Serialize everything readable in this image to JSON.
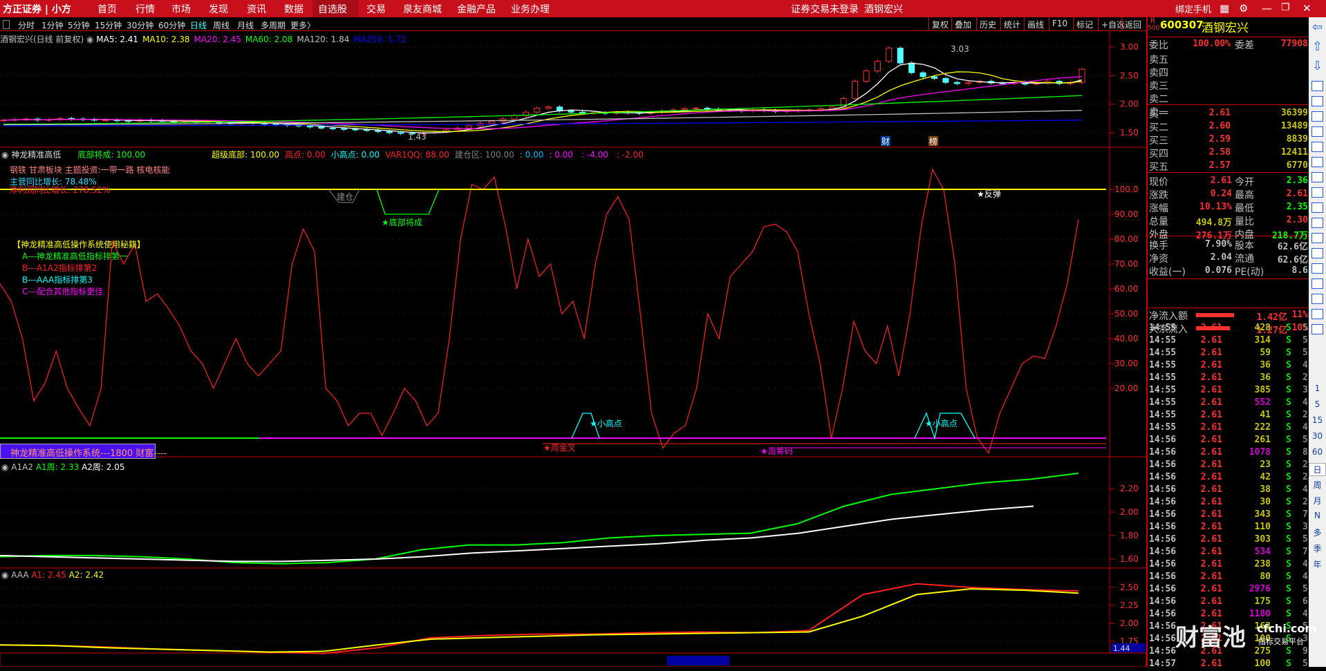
{
  "nav": {
    "logo": "方正证券 | 小方",
    "items": [
      "首页",
      "行情",
      "市场",
      "发现",
      "资讯",
      "数据",
      "自选股",
      "交易",
      "泉友商城",
      "金融产品",
      "业务办理"
    ],
    "active": "自选股",
    "login_status": "证券交易未登录",
    "stock": "酒钢宏兴",
    "bind_phone": "绑定手机"
  },
  "periods": [
    "分时",
    "1分钟",
    "5分钟",
    "15分钟",
    "30分钟",
    "60分钟",
    "日线",
    "周线",
    "月线",
    "多周期",
    "更多〉"
  ],
  "active_period": "日线",
  "toolbar": [
    "复权",
    "叠加",
    "历史",
    "统计",
    "画线",
    "F10",
    "标记",
    "+自选",
    "返回"
  ],
  "main_legend": {
    "title": "酒钢宏兴(日线 前复权)",
    "ma": [
      {
        "t": "MA5: 2.41",
        "c": "#ffffff"
      },
      {
        "t": "MA10: 2.38",
        "c": "#ffff00"
      },
      {
        "t": "MA20: 2.45",
        "c": "#ff00ff"
      },
      {
        "t": "MA60: 2.08",
        "c": "#00ff00"
      },
      {
        "t": "MA120: 1.84",
        "c": "#c0c0c0"
      },
      {
        "t": "MA250: 1.72",
        "c": "#0000ff"
      }
    ]
  },
  "ind1": {
    "name": "神龙精准高低",
    "values": [
      {
        "t": "底部将成: 100.00",
        "c": "#00ff00"
      },
      {
        "t": "超级底部: 100.00",
        "c": "#ffff00"
      },
      {
        "t": "高点: 0.00",
        "c": "#ff2020"
      },
      {
        "t": "小高点: 0.00",
        "c": "#00ffff"
      },
      {
        "t": "VAR1QQ: 88.00",
        "c": "#ff2020"
      },
      {
        "t": "建仓区: 100.00",
        "c": "#808080"
      },
      {
        "t": ": 0.00",
        "c": "#00c0ff"
      },
      {
        "t": ": 0.00",
        "c": "#ff00ff"
      },
      {
        "t": ": -4.00",
        "c": "#ff00ff"
      },
      {
        "t": ": -2.00",
        "c": "#ff2020"
      }
    ],
    "sector": "钢铁 甘肃板块 主题投资:一带一路 核电核能",
    "revenue": "主营同比增长: 78.48%",
    "profit": "净利润同比增长: 278.52%",
    "guide": [
      "【神龙精准高低操作系统使用秘籍】",
      "A---神龙精准高低指标排第一",
      "B---A1A2指标排第2",
      "B---AAA指标排第3",
      "C---配合其他指标更佳"
    ],
    "labels": {
      "jiancang": "建仓",
      "bottom": "★底部将成",
      "rebound": "★反弹",
      "small_high": "★小高点",
      "week_cross": "★周金叉",
      "week_chip": "★周筹码"
    },
    "banner": "神龙精准高低操作系统---1800 财富----"
  },
  "ind2": {
    "name": "A1A2",
    "a1": "A1周: 2.33",
    "a2": "A2周: 2.05"
  },
  "ind3": {
    "name": "AAA",
    "a1": "A1: 2.45",
    "a2": "A2: 2.42"
  },
  "chart_data": [
    {
      "type": "candlestick",
      "ylim": [
        1.35,
        3.2
      ],
      "yticks": [
        "3.00",
        "2.50",
        "2.00",
        "1.50"
      ],
      "high_label": "3.03",
      "low_label": "1.43",
      "markers": [
        "财",
        "榜"
      ],
      "closes": [
        1.72,
        1.73,
        1.74,
        1.72,
        1.73,
        1.75,
        1.74,
        1.73,
        1.72,
        1.72,
        1.71,
        1.7,
        1.72,
        1.71,
        1.7,
        1.69,
        1.7,
        1.68,
        1.69,
        1.67,
        1.66,
        1.68,
        1.67,
        1.65,
        1.64,
        1.63,
        1.62,
        1.6,
        1.58,
        1.57,
        1.56,
        1.55,
        1.54,
        1.52,
        1.5,
        1.49,
        1.48,
        1.5,
        1.52,
        1.55,
        1.58,
        1.62,
        1.66,
        1.7,
        1.74,
        1.8,
        1.86,
        1.93,
        1.95,
        1.88,
        1.86,
        1.84,
        1.85,
        1.84,
        1.86,
        1.85,
        1.84,
        1.86,
        1.88,
        1.9,
        1.92,
        1.93,
        1.91,
        1.9,
        1.89,
        1.88,
        1.9,
        1.89,
        1.87,
        1.88,
        1.89,
        1.9,
        1.92,
        1.95,
        2.1,
        2.4,
        2.58,
        2.75,
        2.98,
        2.72,
        2.55,
        2.48,
        2.45,
        2.38,
        2.36,
        2.38,
        2.4,
        2.37,
        2.36,
        2.38,
        2.35,
        2.37,
        2.4,
        2.36,
        2.38,
        2.61
      ]
    },
    {
      "type": "line",
      "ylim": [
        -8,
        112
      ],
      "yticks": [
        "100.0",
        "90.00",
        "80.00",
        "70.00",
        "60.00",
        "50.00",
        "40.00",
        "30.00",
        "20.00"
      ],
      "series": [
        {
          "values": [
            62,
            55,
            40,
            15,
            22,
            35,
            20,
            12,
            5,
            20,
            79,
            70,
            78,
            55,
            58,
            52,
            45,
            35,
            30,
            20,
            30,
            40,
            30,
            25,
            30,
            35,
            70,
            84,
            75,
            20,
            15,
            5,
            10,
            10,
            1,
            10,
            20,
            15,
            5,
            10,
            40,
            80,
            102,
            100,
            105,
            85,
            60,
            80,
            65,
            70,
            50,
            55,
            40,
            70,
            90,
            97,
            88,
            50,
            10,
            -4,
            2,
            5,
            20,
            50,
            40,
            65,
            70,
            75,
            85,
            86,
            83,
            75,
            50,
            30,
            0,
            20,
            47,
            35,
            30,
            45,
            25,
            50,
            85,
            108,
            100,
            70,
            20,
            0,
            -6,
            10,
            20,
            30,
            33,
            32,
            45,
            62,
            88
          ],
          "color": "#ff2020"
        }
      ]
    },
    {
      "type": "line",
      "ylim": [
        1.52,
        2.35
      ],
      "yticks": [
        "2.20",
        "2.00",
        "1.80",
        "1.60"
      ],
      "series": [
        {
          "name": "A1周",
          "values": [
            1.62,
            1.63,
            1.63,
            1.62,
            1.6,
            1.57,
            1.56,
            1.57,
            1.6,
            1.68,
            1.72,
            1.72,
            1.74,
            1.78,
            1.8,
            1.81,
            1.82,
            1.9,
            2.05,
            2.15,
            2.2,
            2.25,
            2.28,
            2.33
          ],
          "color": "#00ff00"
        },
        {
          "name": "A2周",
          "values": [
            1.63,
            1.62,
            1.61,
            1.6,
            1.59,
            1.58,
            1.58,
            1.59,
            1.6,
            1.62,
            1.65,
            1.67,
            1.69,
            1.71,
            1.73,
            1.76,
            1.78,
            1.82,
            1.88,
            1.94,
            1.98,
            2.02,
            2.05
          ],
          "color": "#ffffff"
        }
      ]
    },
    {
      "type": "line",
      "ylim": [
        1.5,
        2.65
      ],
      "yticks": [
        "2.50",
        "2.25",
        "2.00",
        "1.75"
      ],
      "last_label": "1.44",
      "series": [
        {
          "name": "A1",
          "values": [
            1.7,
            1.69,
            1.67,
            1.64,
            1.62,
            1.6,
            1.58,
            1.66,
            1.8,
            1.83,
            1.85,
            1.85,
            1.87,
            1.88,
            1.87,
            1.9,
            2.4,
            2.55,
            2.5,
            2.47,
            2.45
          ],
          "color": "#ff2020"
        },
        {
          "name": "A2",
          "values": [
            1.7,
            1.69,
            1.66,
            1.64,
            1.62,
            1.6,
            1.61,
            1.7,
            1.78,
            1.8,
            1.82,
            1.84,
            1.85,
            1.86,
            1.87,
            1.88,
            2.1,
            2.4,
            2.48,
            2.46,
            2.42
          ],
          "color": "#ffff00"
        }
      ]
    }
  ],
  "quote": {
    "code": "600307",
    "name": "酒钢宏兴",
    "badge_r": "R",
    "badge_n": "500",
    "weibi_l": "委比",
    "weibi": "100.00%",
    "weicha_l": "委差",
    "weicha": "77908",
    "sell": [
      "卖五",
      "卖四",
      "卖三",
      "卖二",
      "卖一"
    ],
    "buy": [
      {
        "l": "买一",
        "p": "2.61",
        "v": "36399"
      },
      {
        "l": "买二",
        "p": "2.60",
        "v": "13489"
      },
      {
        "l": "买三",
        "p": "2.59",
        "v": "8839"
      },
      {
        "l": "买四",
        "p": "2.58",
        "v": "12411"
      },
      {
        "l": "买五",
        "p": "2.57",
        "v": "6770"
      }
    ],
    "stats": [
      {
        "l1": "现价",
        "v1": "2.61",
        "c1": "#ff3030",
        "l2": "今开",
        "v2": "2.36",
        "c2": "#00ff00"
      },
      {
        "l1": "涨跌",
        "v1": "0.24",
        "c1": "#ff3030",
        "l2": "最高",
        "v2": "2.61",
        "c2": "#ff3030"
      },
      {
        "l1": "涨幅",
        "v1": "10.13%",
        "c1": "#ff3030",
        "l2": "最低",
        "v2": "2.35",
        "c2": "#00ff00"
      },
      {
        "l1": "总量",
        "v1": "494.8万",
        "c1": "#c8c800",
        "l2": "量比",
        "v2": "2.30",
        "c2": "#ff3030"
      },
      {
        "l1": "外盘",
        "v1": "276.1万",
        "c1": "#ff3030",
        "l2": "内盘",
        "v2": "218.7万",
        "c2": "#00ff00"
      }
    ],
    "fund": [
      {
        "l1": "换手",
        "v1": "7.90%",
        "l2": "股本",
        "v2": "62.6亿"
      },
      {
        "l1": "净资",
        "v1": "2.04",
        "l2": "流通",
        "v2": "62.6亿"
      },
      {
        "l1": "收益(一)",
        "v1": "0.076",
        "l2": "PE(动)",
        "v2": "8.6"
      }
    ],
    "flows": [
      {
        "l": "净流入额",
        "v": "1.42亿",
        "p": "11%"
      },
      {
        "l": "大宗流入",
        "v": "1.27亿",
        "p": "10%"
      }
    ]
  },
  "ticks": [
    [
      "14:55",
      "2.61",
      "428",
      "S",
      "5"
    ],
    [
      "14:55",
      "2.61",
      "314",
      "S",
      "5"
    ],
    [
      "14:55",
      "2.61",
      "59",
      "S",
      "5"
    ],
    [
      "14:55",
      "2.61",
      "36",
      "S",
      "4"
    ],
    [
      "14:55",
      "2.61",
      "36",
      "S",
      "2"
    ],
    [
      "14:55",
      "2.61",
      "385",
      "S",
      "3"
    ],
    [
      "14:55",
      "2.61",
      "552",
      "S",
      "4"
    ],
    [
      "14:55",
      "2.61",
      "41",
      "S",
      "2"
    ],
    [
      "14:55",
      "2.61",
      "222",
      "S",
      "4"
    ],
    [
      "14:56",
      "2.61",
      "261",
      "S",
      "5"
    ],
    [
      "14:56",
      "2.61",
      "1078",
      "S",
      "8"
    ],
    [
      "14:56",
      "2.61",
      "23",
      "S",
      "2"
    ],
    [
      "14:56",
      "2.61",
      "42",
      "S",
      "2"
    ],
    [
      "14:56",
      "2.61",
      "38",
      "S",
      "4"
    ],
    [
      "14:56",
      "2.61",
      "30",
      "S",
      "2"
    ],
    [
      "14:56",
      "2.61",
      "343",
      "S",
      "7"
    ],
    [
      "14:56",
      "2.61",
      "110",
      "S",
      "3"
    ],
    [
      "14:56",
      "2.61",
      "303",
      "S",
      "5"
    ],
    [
      "14:56",
      "2.61",
      "534",
      "S",
      "7"
    ],
    [
      "14:56",
      "2.61",
      "238",
      "S",
      "4"
    ],
    [
      "14:56",
      "2.61",
      "80",
      "S",
      "4"
    ],
    [
      "14:56",
      "2.61",
      "2976",
      "S",
      "5"
    ],
    [
      "14:56",
      "2.61",
      "175",
      "S",
      "6"
    ],
    [
      "14:56",
      "2.61",
      "1180",
      "S",
      "4"
    ],
    [
      "14:56",
      "2.61",
      "163",
      "S",
      "5"
    ],
    [
      "14:56",
      "2.61",
      "100",
      "S",
      "3"
    ],
    [
      "14:56",
      "2.61",
      "275",
      "S",
      "9"
    ],
    [
      "14:57",
      "2.61",
      "100",
      "S",
      "5"
    ]
  ],
  "side_periods": [
    "1",
    "5",
    "15",
    "30",
    "60",
    "日",
    "周",
    "月",
    "N",
    "多",
    "季",
    "年"
  ],
  "watermark": {
    "big": "财富池",
    "site": "cfchi.com",
    "sub": "指标交易平台"
  },
  "colors": {
    "up": "#ff3030",
    "down": "#54ffff",
    "accent": "#c8101c"
  }
}
